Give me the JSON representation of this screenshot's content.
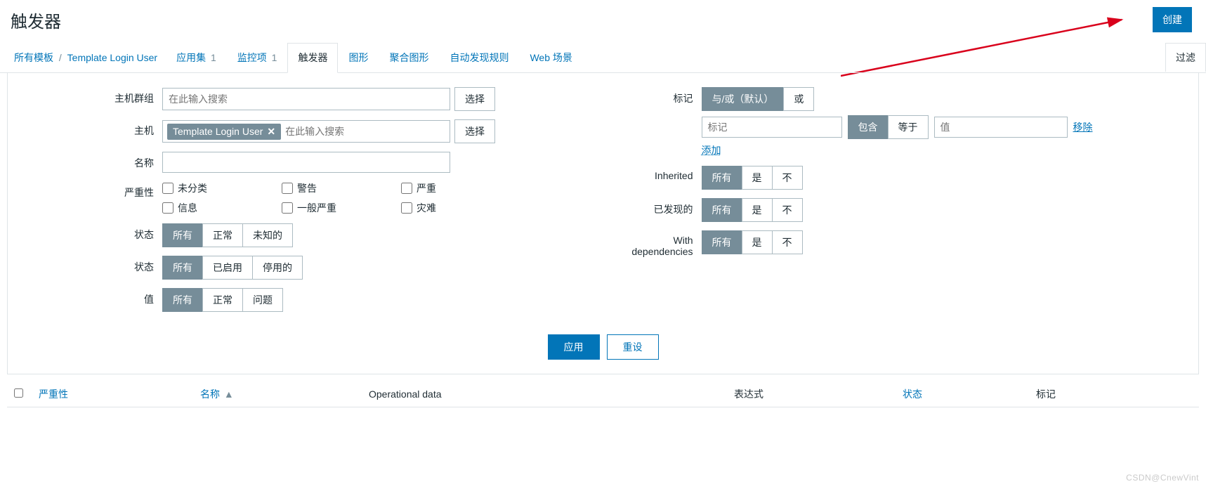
{
  "page": {
    "title": "触发器",
    "create_btn": "创建"
  },
  "breadcrumb": {
    "all_templates": "所有模板",
    "current": "Template Login User"
  },
  "tabs": {
    "apps": {
      "label": "应用集",
      "count": "1"
    },
    "items": {
      "label": "监控项",
      "count": "1"
    },
    "triggers": {
      "label": "触发器"
    },
    "graphs": {
      "label": "图形"
    },
    "screens": {
      "label": "聚合图形"
    },
    "discovery": {
      "label": "自动发现规则"
    },
    "web": {
      "label": "Web 场景"
    }
  },
  "filter_toggle": "过滤",
  "filter": {
    "hostgroup": {
      "label": "主机群组",
      "placeholder": "在此输入搜索",
      "select_btn": "选择"
    },
    "host": {
      "label": "主机",
      "chip": "Template Login User",
      "placeholder": "在此输入搜索",
      "select_btn": "选择"
    },
    "name": {
      "label": "名称",
      "value": ""
    },
    "severity": {
      "label": "严重性",
      "opts": [
        "未分类",
        "警告",
        "严重",
        "信息",
        "一般严重",
        "灾难"
      ]
    },
    "state": {
      "label": "状态",
      "opts": [
        "所有",
        "正常",
        "未知的"
      ],
      "active": 0
    },
    "status": {
      "label": "状态",
      "opts": [
        "所有",
        "已启用",
        "停用的"
      ],
      "active": 0
    },
    "value": {
      "label": "值",
      "opts": [
        "所有",
        "正常",
        "问题"
      ],
      "active": 0
    },
    "tags": {
      "label": "标记",
      "andor": {
        "opts": [
          "与/或（默认）",
          "或"
        ],
        "active": 0
      },
      "tag_placeholder": "标记",
      "op1": {
        "opts": [
          "包含",
          "等于"
        ],
        "active": 0
      },
      "val_placeholder": "值",
      "remove": "移除",
      "add": "添加"
    },
    "inherited": {
      "label": "Inherited",
      "opts": [
        "所有",
        "是",
        "不"
      ],
      "active": 0
    },
    "discovered": {
      "label": "已发现的",
      "opts": [
        "所有",
        "是",
        "不"
      ],
      "active": 0
    },
    "withdeps": {
      "label": "With dependencies",
      "opts": [
        "所有",
        "是",
        "不"
      ],
      "active": 0
    },
    "actions": {
      "apply": "应用",
      "reset": "重设"
    }
  },
  "table": {
    "cols": {
      "severity": "严重性",
      "name": "名称",
      "opdata": "Operational data",
      "expression": "表达式",
      "status": "状态",
      "tags": "标记"
    },
    "sort_indicator": "▲"
  },
  "watermark": "CSDN@CnewVint"
}
